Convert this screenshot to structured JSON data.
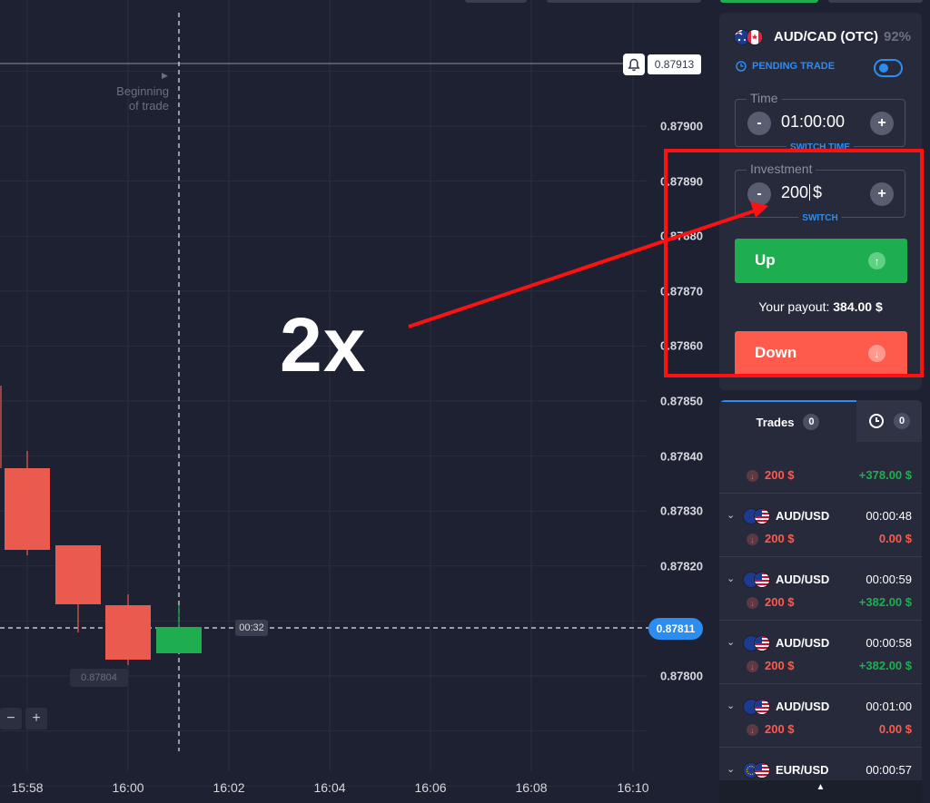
{
  "chart": {
    "y_axis_labels": [
      "0.87900",
      "0.87890",
      "0.87880",
      "0.87870",
      "0.87860",
      "0.87850",
      "0.87840",
      "0.87830",
      "0.87820",
      "0.87800"
    ],
    "x_axis_labels": [
      "15:58",
      "16:00",
      "16:02",
      "16:04",
      "16:06",
      "16:08",
      "16:10"
    ],
    "beginning_of_trade": "Beginning\nof trade",
    "alert_price": "0.87913",
    "current_price": "0.87811",
    "countdown": "00:32",
    "low_price": "0.87804",
    "zoom_out": "−",
    "zoom_in": "+",
    "colors": {
      "bull": "#1fae4f",
      "bear": "#eb5a4f",
      "accent": "#2d8cf0"
    }
  },
  "annotation": {
    "big_text": "2x",
    "highlight_color": "#ff1111"
  },
  "trade_panel": {
    "asset": "AUD/CAD (OTC)",
    "payout_percent": "92%",
    "pending_label": "PENDING TRADE",
    "time_legend": "Time",
    "time_value": "01:00:00",
    "switch_time": "SWITCH TIME",
    "investment_legend": "Investment",
    "investment_value": "200",
    "investment_currency": "$",
    "switch": "SWITCH",
    "minus": "-",
    "plus": "+",
    "up_label": "Up",
    "down_label": "Down",
    "payout_prefix": "Your payout:",
    "payout_value": "384.00 $"
  },
  "trades": {
    "tab_label": "Trades",
    "tab_count": "0",
    "history_count": "0",
    "items": [
      {
        "asset": "",
        "time": "",
        "amount": "200 $",
        "profit": "+378.00 $",
        "profit_color": "#1fae4f"
      },
      {
        "asset": "AUD/USD",
        "time": "00:00:48",
        "amount": "200 $",
        "profit": "0.00 $",
        "profit_color": "#ff5b4d"
      },
      {
        "asset": "AUD/USD",
        "time": "00:00:59",
        "amount": "200 $",
        "profit": "+382.00 $",
        "profit_color": "#1fae4f"
      },
      {
        "asset": "AUD/USD",
        "time": "00:00:58",
        "amount": "200 $",
        "profit": "+382.00 $",
        "profit_color": "#1fae4f"
      },
      {
        "asset": "AUD/USD",
        "time": "00:01:00",
        "amount": "200 $",
        "profit": "0.00 $",
        "profit_color": "#ff5b4d"
      },
      {
        "asset": "EUR/USD",
        "time": "00:00:57",
        "amount": "",
        "profit": "",
        "profit_color": "#1fae4f"
      }
    ]
  }
}
